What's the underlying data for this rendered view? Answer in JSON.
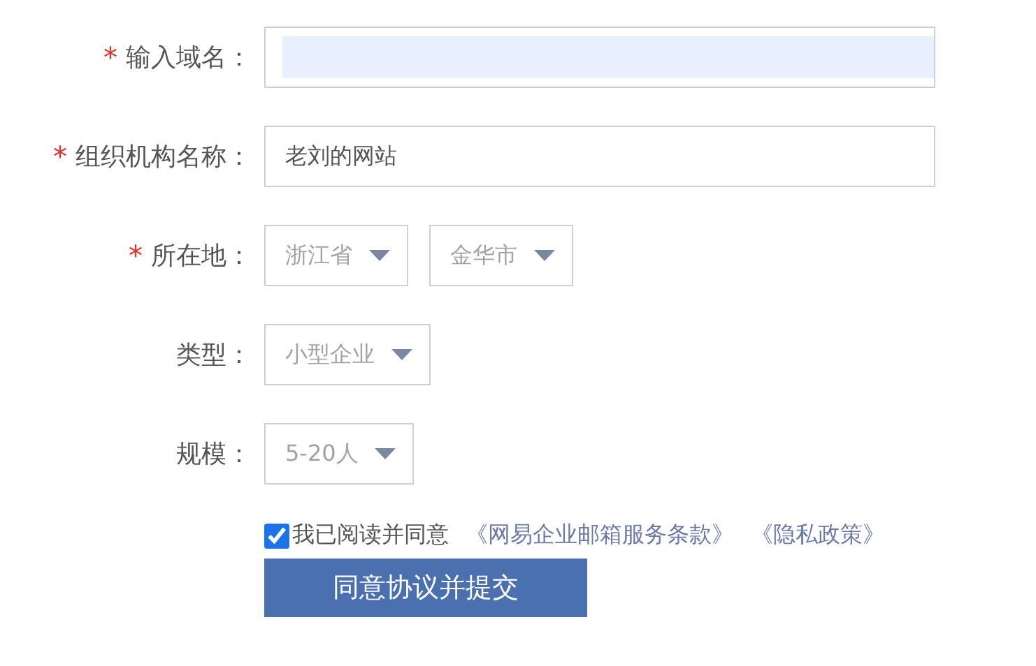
{
  "form": {
    "rows": [
      {
        "kind": "text",
        "required_mark": "*",
        "label": "输入域名：",
        "autofill": true
      },
      {
        "kind": "text",
        "required_mark": "*",
        "label": "组织机构名称：",
        "value": "老刘的网站",
        "autofill": false
      },
      {
        "kind": "select",
        "required_mark": "*",
        "label": "所在地：",
        "selects": [
          {
            "value": "浙江省"
          },
          {
            "value": "金华市"
          }
        ]
      },
      {
        "kind": "select",
        "label": "类型：",
        "selects": [
          {
            "value": "小型企业"
          }
        ]
      },
      {
        "kind": "select",
        "label": "规模：",
        "selects": [
          {
            "value": "5-20人"
          }
        ]
      }
    ]
  },
  "agreement": {
    "checked": true,
    "text": "我已阅读并同意",
    "links": [
      "《网易企业邮箱服务条款》",
      "《隐私政策》"
    ]
  },
  "submit": "同意协议并提交"
}
